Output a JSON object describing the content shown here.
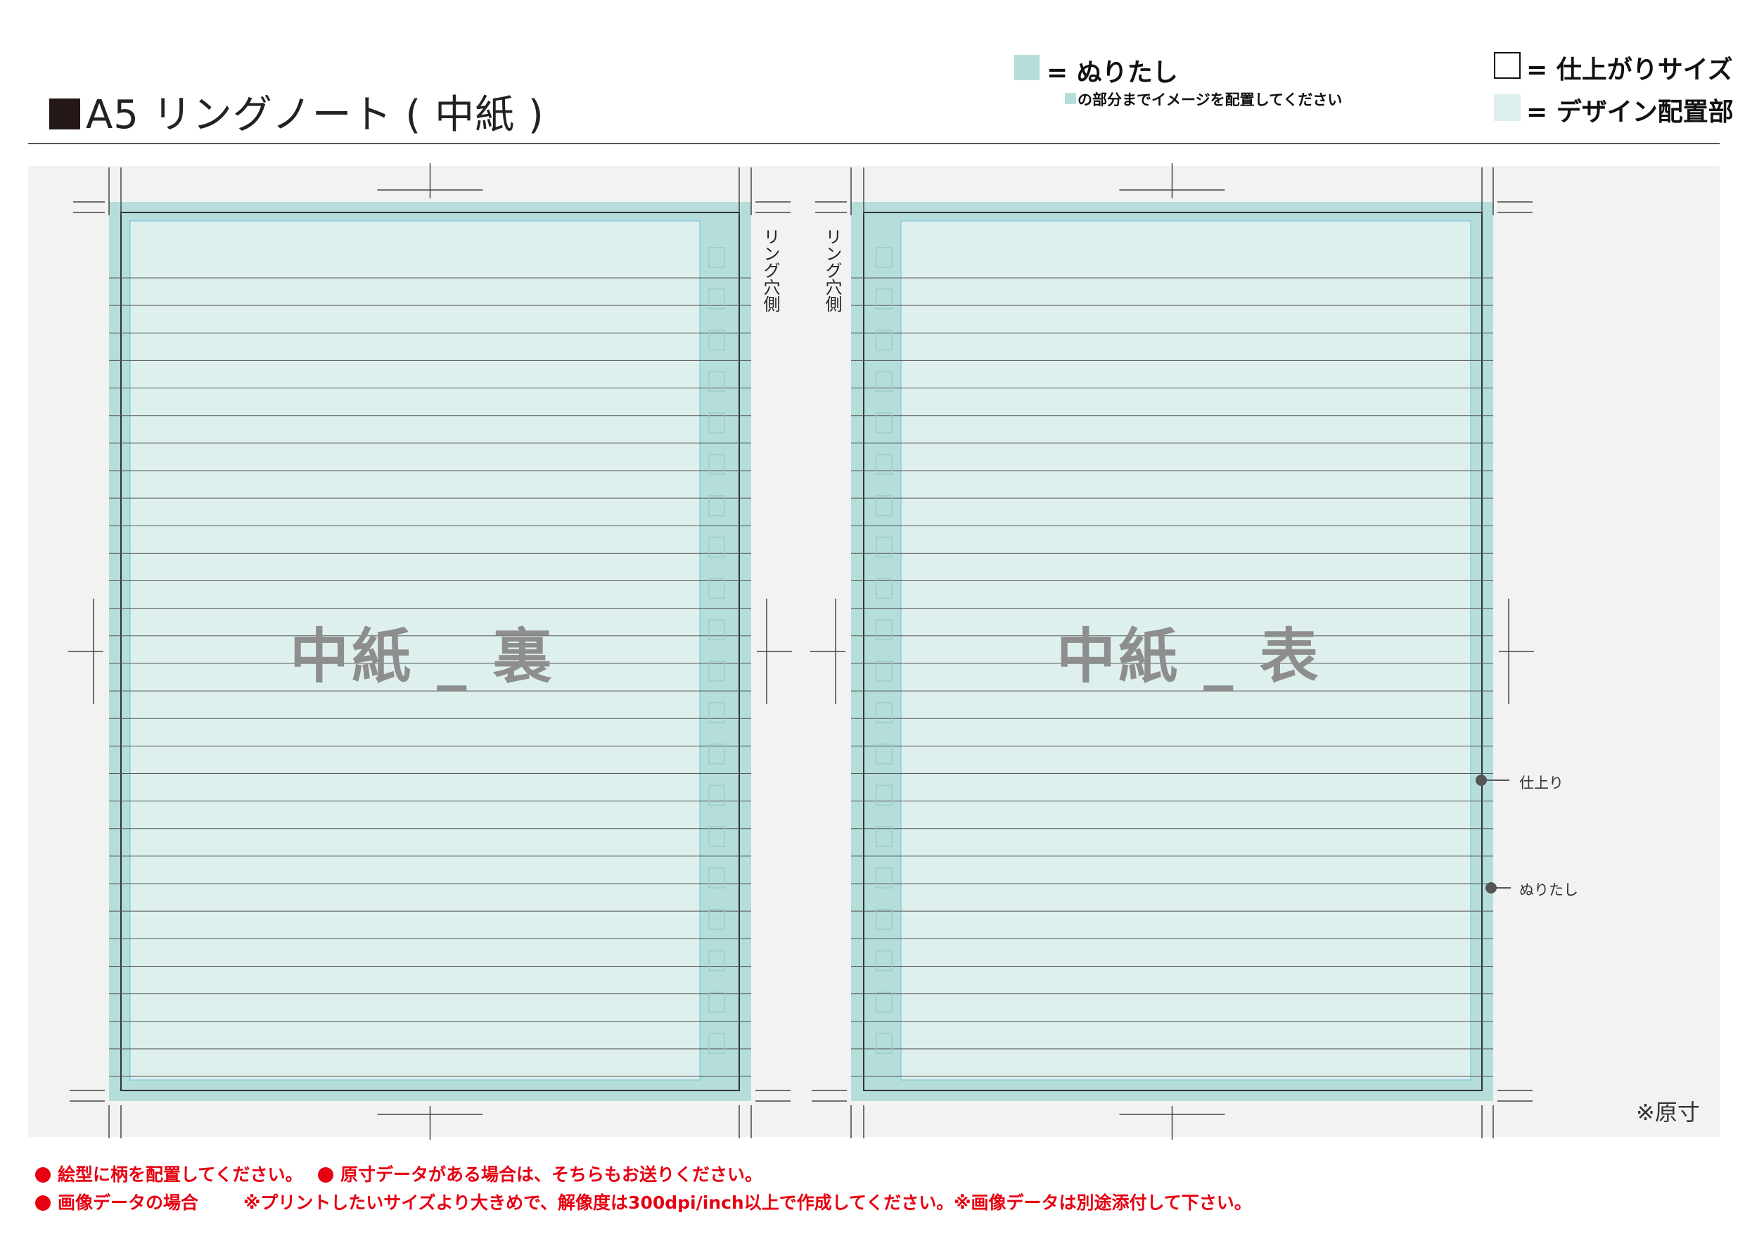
{
  "header": {
    "title": "A5 リングノート ( 中紙 )"
  },
  "legend": {
    "bleed_label": "= ぬりたし",
    "bleed_note": "の部分までイメージを配置してください",
    "finish_label": "= 仕上がりサイズ",
    "design_label": "= デザイン配置部",
    "bleed_color": "#b5dedb",
    "design_color": "#ddf0ee"
  },
  "pages": {
    "back_label": "中紙 _ 裏",
    "front_label": "中紙 _ 表",
    "ring_side_label": "リング穴側",
    "ruled_lines": 30,
    "ring_holes": 20
  },
  "callouts": {
    "finish": "仕上り",
    "bleed": "ぬりたし"
  },
  "scale_note": "※原寸",
  "notes": {
    "note1": "絵型に柄を配置してください。",
    "note2": "原寸データがある場合は、そちらもお送りください。",
    "note3": "画像データの場合",
    "note4": "※プリントしたいサイズより大きめで、解像度は300dpi/inch以上で作成してください。※画像データは別途添付して下さい。"
  }
}
